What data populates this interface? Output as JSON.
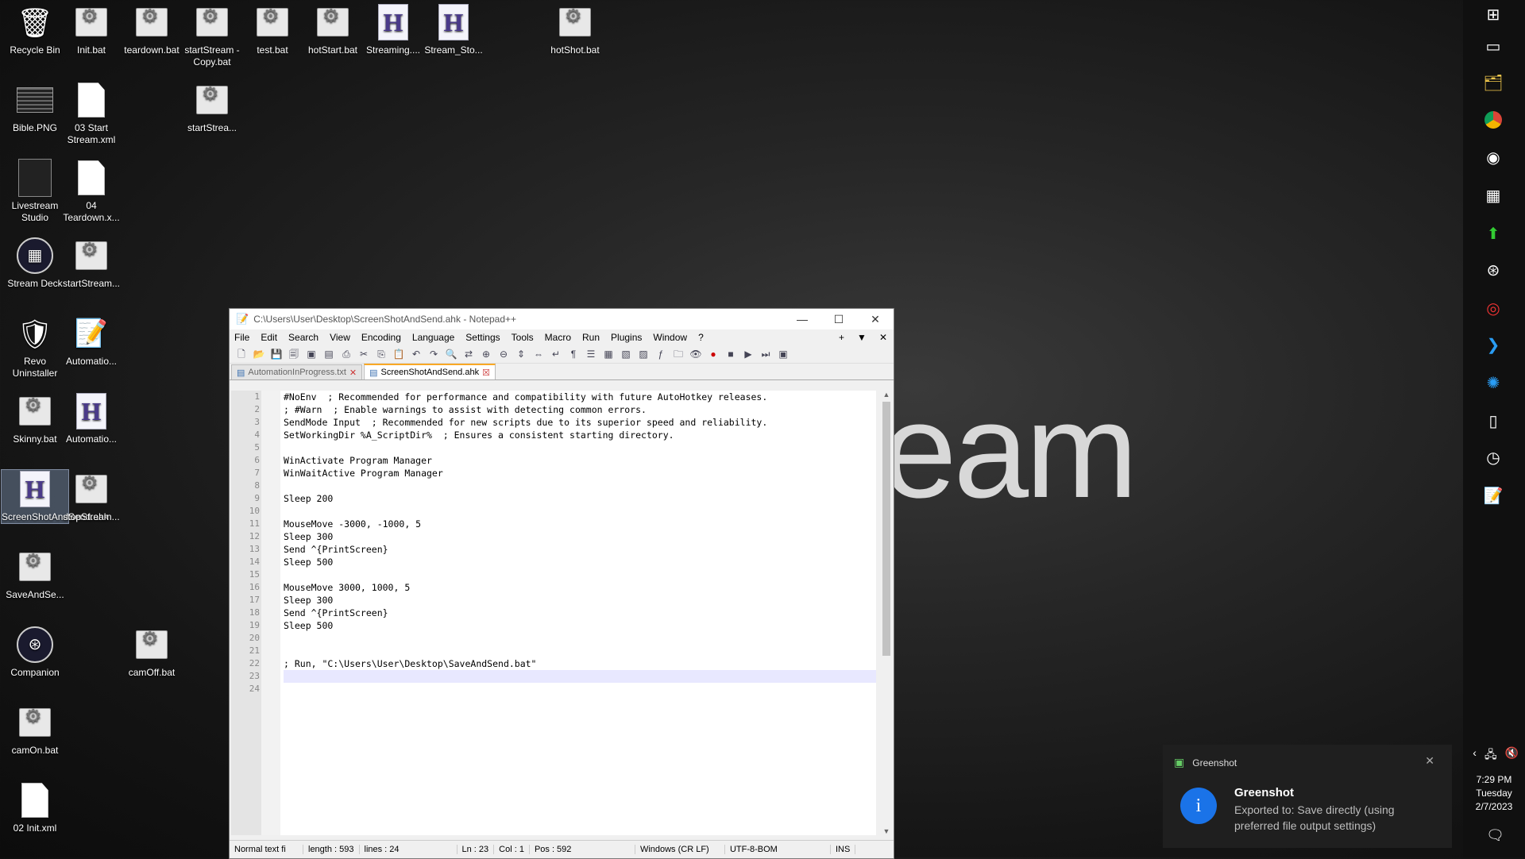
{
  "wallpaper_text": "eam",
  "desktop_icons": [
    {
      "label": "Recycle Bin",
      "icon": "recycle-bin-icon"
    },
    {
      "label": "Init.bat",
      "icon": "batch-file-icon"
    },
    {
      "label": "teardown.bat",
      "icon": "batch-file-icon"
    },
    {
      "label": "startStream - Copy.bat",
      "icon": "batch-file-icon"
    },
    {
      "label": "test.bat",
      "icon": "batch-file-icon"
    },
    {
      "label": "hotStart.bat",
      "icon": "batch-file-icon"
    },
    {
      "label": "Streaming....",
      "icon": "autohotkey-file-icon"
    },
    {
      "label": "Stream_Sto...",
      "icon": "autohotkey-file-icon"
    },
    {
      "label": "hotShot.bat",
      "icon": "batch-file-icon"
    },
    {
      "label": "Bible.PNG",
      "icon": "image-file-icon"
    },
    {
      "label": "03 Start Stream.xml",
      "icon": "document-icon"
    },
    {
      "label": "startStrea...",
      "icon": "batch-file-icon"
    },
    {
      "label": "Livestream Studio",
      "icon": "livestream-studio-icon"
    },
    {
      "label": "04 Teardown.x...",
      "icon": "document-icon"
    },
    {
      "label": "Stream Deck",
      "icon": "stream-deck-icon"
    },
    {
      "label": "startStream...",
      "icon": "batch-file-icon"
    },
    {
      "label": "Revo Uninstaller",
      "icon": "revo-uninstaller-icon"
    },
    {
      "label": "Automatio...",
      "icon": "notepadpp-file-icon"
    },
    {
      "label": "Skinny.bat",
      "icon": "batch-file-icon"
    },
    {
      "label": "Automatio...",
      "icon": "autohotkey-file-icon"
    },
    {
      "label": "ScreenShotAndSend.ahk",
      "icon": "autohotkey-file-icon"
    },
    {
      "label": "stopStream...",
      "icon": "batch-file-icon"
    },
    {
      "label": "SaveAndSe...",
      "icon": "batch-file-icon"
    },
    {
      "label": "Companion",
      "icon": "companion-icon"
    },
    {
      "label": "camOff.bat",
      "icon": "batch-file-icon"
    },
    {
      "label": "camOn.bat",
      "icon": "batch-file-icon"
    },
    {
      "label": "02 Init.xml",
      "icon": "document-icon"
    }
  ],
  "window": {
    "title": "C:\\Users\\User\\Desktop\\ScreenShotAndSend.ahk - Notepad++",
    "minimize": "—",
    "maximize": "☐",
    "close": "✕"
  },
  "menu": [
    "File",
    "Edit",
    "Search",
    "View",
    "Encoding",
    "Language",
    "Settings",
    "Tools",
    "Macro",
    "Run",
    "Plugins",
    "Window",
    "?"
  ],
  "menu_right": [
    "+",
    "▼",
    "✕"
  ],
  "tabs": [
    {
      "label": "AutomationInProgress.txt",
      "active": false
    },
    {
      "label": "ScreenShotAndSend.ahk",
      "active": true
    }
  ],
  "code_lines": [
    "#NoEnv  ; Recommended for performance and compatibility with future AutoHotkey releases.",
    "; #Warn  ; Enable warnings to assist with detecting common errors.",
    "SendMode Input  ; Recommended for new scripts due to its superior speed and reliability.",
    "SetWorkingDir %A_ScriptDir%  ; Ensures a consistent starting directory.",
    "",
    "WinActivate Program Manager",
    "WinWaitActive Program Manager",
    "",
    "Sleep 200",
    "",
    "MouseMove -3000, -1000, 5",
    "Sleep 300",
    "Send ^{PrintScreen}",
    "Sleep 500",
    "",
    "MouseMove 3000, 1000, 5",
    "Sleep 300",
    "Send ^{PrintScreen}",
    "Sleep 500",
    "",
    "",
    "; Run, \"C:\\Users\\User\\Desktop\\SaveAndSend.bat\"",
    "",
    ""
  ],
  "current_line": 23,
  "status": {
    "type": "Normal text fi",
    "length": "length : 593",
    "lines": "lines : 24",
    "ln": "Ln : 23",
    "col": "Col : 1",
    "pos": "Pos : 592",
    "eol": "Windows (CR LF)",
    "encoding": "UTF-8-BOM",
    "mode": "INS"
  },
  "toast": {
    "app": "Greenshot",
    "title": "Greenshot",
    "message": "Exported to: Save directly (using preferred file output settings)"
  },
  "clock": {
    "time": "7:29 PM",
    "day": "Tuesday",
    "date": "2/7/2023"
  }
}
